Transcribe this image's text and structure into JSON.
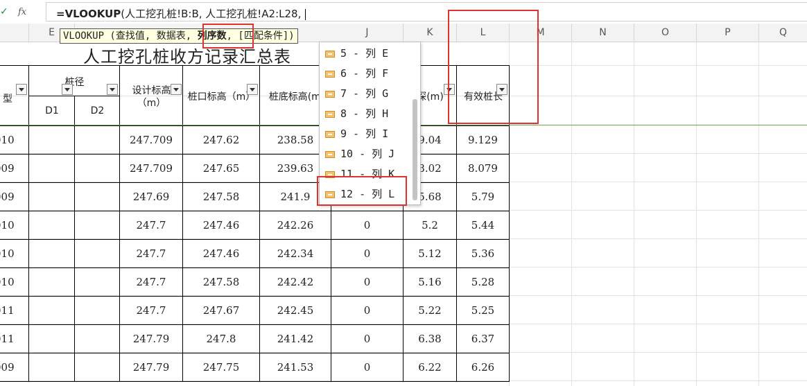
{
  "formula_bar": {
    "check_icon": "check-icon",
    "fx_label": "fx",
    "formula_fn": "=VLOOKUP",
    "formula_args": "(人工挖孔桩!B:B, 人工挖孔桩!A2:L28, "
  },
  "columns": [
    "E",
    "J",
    "K",
    "L",
    "M",
    "N",
    "O",
    "P",
    "Q"
  ],
  "tooltip": {
    "prefix": "VLOOKUP (查找值, 数据表, ",
    "active_arg": "列序数",
    "suffix": ", [匹配条件])"
  },
  "sheet": {
    "title": "人工挖孔桩收方记录汇总表",
    "headers": {
      "type": "型",
      "diameter": "桩径",
      "d1": "D1",
      "d2": "D2",
      "design_elev": "设计标高",
      "design_elev_unit": "（m）",
      "top_elev": "桩口标高（m）",
      "bottom_elev": "桩底标高(m)",
      "depth": "深(m)",
      "effective_len": "有效桩长"
    },
    "rows": [
      {
        "type": "010",
        "design": "247.709",
        "top": "247.62",
        "bottom": "238.58",
        "j": "",
        "k": "9.04",
        "l": "9.129"
      },
      {
        "type": "009",
        "design": "247.709",
        "top": "247.65",
        "bottom": "239.63",
        "j": "",
        "k": "8.02",
        "l": "8.079"
      },
      {
        "type": "009",
        "design": "247.69",
        "top": "247.58",
        "bottom": "241.9",
        "j": "",
        "k": "5.68",
        "l": "5.79"
      },
      {
        "type": "010",
        "design": "247.7",
        "top": "247.46",
        "bottom": "242.26",
        "j": "0",
        "k": "5.2",
        "l": "5.44"
      },
      {
        "type": "010",
        "design": "247.7",
        "top": "247.46",
        "bottom": "242.34",
        "j": "0",
        "k": "5.12",
        "l": "5.36"
      },
      {
        "type": "010",
        "design": "247.7",
        "top": "247.58",
        "bottom": "242.42",
        "j": "0",
        "k": "5.16",
        "l": "5.28"
      },
      {
        "type": "011",
        "design": "247.7",
        "top": "247.67",
        "bottom": "242.45",
        "j": "0",
        "k": "5.22",
        "l": "5.25"
      },
      {
        "type": "011",
        "design": "247.79",
        "top": "247.8",
        "bottom": "241.42",
        "j": "0",
        "k": "6.38",
        "l": "6.37"
      },
      {
        "type": "009",
        "design": "247.79",
        "top": "247.75",
        "bottom": "241.53",
        "j": "0",
        "k": "6.22",
        "l": "6.26"
      }
    ]
  },
  "autocomplete": {
    "items": [
      "5 - 列 E",
      "6 - 列 F",
      "7 - 列 G",
      "8 - 列 H",
      "9 - 列 I",
      "10 - 列 J",
      "11 - 列 K",
      "12 - 列 L"
    ],
    "item_icon": "column-icon"
  },
  "colors": {
    "highlight": "#e03030",
    "freeze_line": "#6aaa45"
  }
}
